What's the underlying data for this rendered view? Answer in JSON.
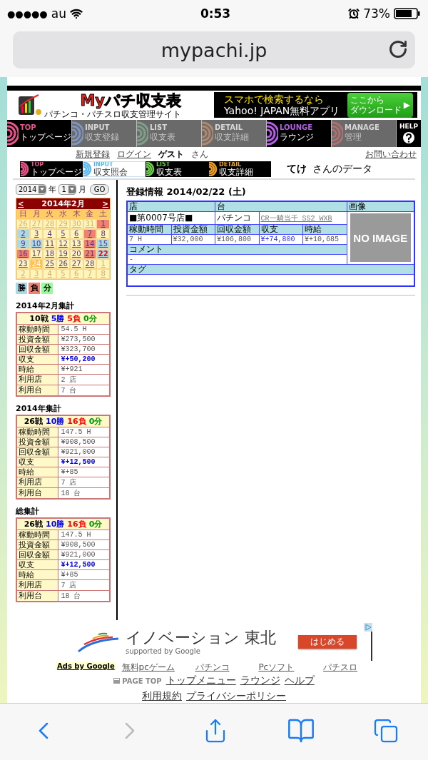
{
  "status_bar": {
    "signal": "●●●●●",
    "carrier": "au",
    "time": "0:53",
    "battery": "73%"
  },
  "browser": {
    "url": "mypachi.jp"
  },
  "header": {
    "logo": "Myパチ収支表",
    "logo_sub": "パチンコ・パチスロ収支管理サイト",
    "ad_line1": "スマホで検索するなら",
    "ad_line2": "Yahoo! JAPAN無料アプリ",
    "ad_button": [
      "ここから",
      "ダウンロード"
    ],
    "ad_arrow": "▶"
  },
  "nav": {
    "tabs": [
      {
        "en": "TOP",
        "ja": "トップページ",
        "color": "#e8558a",
        "disabled": false
      },
      {
        "en": "INPUT",
        "ja": "収支登録",
        "color": "#7f95c0",
        "disabled": true
      },
      {
        "en": "LIST",
        "ja": "収支表",
        "color": "#7f9f88",
        "disabled": true
      },
      {
        "en": "DETAIL",
        "ja": "収支詳細",
        "color": "#b08870",
        "disabled": true
      },
      {
        "en": "LOUNGE",
        "ja": "ラウンジ",
        "color": "#b45ee6",
        "disabled": false
      },
      {
        "en": "MANAGE",
        "ja": "管理",
        "color": "#b07070",
        "disabled": true
      }
    ],
    "help": "HELP"
  },
  "account": {
    "links": [
      "新規登録",
      "ログイン"
    ],
    "user": "ゲスト",
    "suffix": "さん",
    "contact": "お問い合わせ"
  },
  "sub_tabs": [
    {
      "en": "TOP",
      "ja": "トップページ",
      "color": "#e8558a",
      "selected": false
    },
    {
      "en": "INPUT",
      "ja": "収支照会",
      "color": "#5ab8f0",
      "selected": true
    },
    {
      "en": "LIST",
      "ja": "収支表",
      "color": "#6cd048",
      "selected": false
    },
    {
      "en": "DETAIL",
      "ja": "収支詳細",
      "color": "#f0a020",
      "selected": false
    }
  ],
  "owner": {
    "name": "てけ",
    "suffix": "さんのデータ"
  },
  "picker": {
    "year": "2014",
    "year_unit": "年",
    "month": "1",
    "month_unit": "月",
    "go": "GO"
  },
  "calendar": {
    "prev": "<",
    "title": "2014年2月",
    "next": ">",
    "weekdays": [
      "日",
      "月",
      "火",
      "水",
      "木",
      "金",
      "土"
    ],
    "weeks": [
      {
        "days": [
          {
            "day": "26",
            "kind": "other",
            "selected": false
          },
          {
            "day": "27",
            "kind": "other",
            "selected": false
          },
          {
            "day": "28",
            "kind": "other",
            "selected": false
          },
          {
            "day": "29",
            "kind": "other",
            "selected": false
          },
          {
            "day": "30",
            "kind": "other",
            "selected": false
          },
          {
            "day": "31",
            "kind": "other",
            "selected": false
          },
          {
            "day": "1",
            "kind": "lose",
            "selected": false
          }
        ]
      },
      {
        "days": [
          {
            "day": "2",
            "kind": "win",
            "selected": false
          },
          {
            "day": "3",
            "kind": "plain",
            "selected": false
          },
          {
            "day": "4",
            "kind": "plain",
            "selected": false
          },
          {
            "day": "5",
            "kind": "plain",
            "selected": false
          },
          {
            "day": "6",
            "kind": "plain",
            "selected": false
          },
          {
            "day": "7",
            "kind": "lose",
            "selected": false
          },
          {
            "day": "8",
            "kind": "plain",
            "selected": false
          }
        ]
      },
      {
        "days": [
          {
            "day": "9",
            "kind": "win",
            "selected": false
          },
          {
            "day": "10",
            "kind": "win",
            "selected": false
          },
          {
            "day": "11",
            "kind": "plain",
            "selected": false
          },
          {
            "day": "12",
            "kind": "plain",
            "selected": false
          },
          {
            "day": "13",
            "kind": "plain",
            "selected": false
          },
          {
            "day": "14",
            "kind": "lose",
            "selected": false
          },
          {
            "day": "15",
            "kind": "win",
            "selected": false
          }
        ]
      },
      {
        "days": [
          {
            "day": "16",
            "kind": "lose",
            "selected": false
          },
          {
            "day": "17",
            "kind": "plain",
            "selected": false
          },
          {
            "day": "18",
            "kind": "plain",
            "selected": false
          },
          {
            "day": "19",
            "kind": "plain",
            "selected": false
          },
          {
            "day": "20",
            "kind": "plain",
            "selected": false
          },
          {
            "day": "21",
            "kind": "lose",
            "selected": false
          },
          {
            "day": "22",
            "kind": "win",
            "selected": true
          }
        ]
      },
      {
        "days": [
          {
            "day": "23",
            "kind": "plain",
            "selected": false
          },
          {
            "day": "24",
            "kind": "today",
            "selected": false
          },
          {
            "day": "25",
            "kind": "plain",
            "selected": false
          },
          {
            "day": "26",
            "kind": "plain",
            "selected": false
          },
          {
            "day": "27",
            "kind": "plain",
            "selected": false
          },
          {
            "day": "28",
            "kind": "plain",
            "selected": false
          },
          {
            "day": "1",
            "kind": "other",
            "selected": false
          }
        ]
      },
      {
        "days": [
          {
            "day": "2",
            "kind": "other",
            "selected": false
          },
          {
            "day": "3",
            "kind": "other",
            "selected": false
          },
          {
            "day": "4",
            "kind": "other",
            "selected": false
          },
          {
            "day": "5",
            "kind": "other",
            "selected": false
          },
          {
            "day": "6",
            "kind": "other",
            "selected": false
          },
          {
            "day": "7",
            "kind": "other",
            "selected": false
          },
          {
            "day": "8",
            "kind": "other",
            "selected": false
          }
        ]
      }
    ]
  },
  "legend": [
    {
      "label": "勝",
      "color": "#add8e6"
    },
    {
      "label": "負",
      "color": "#f08070"
    },
    {
      "label": "分",
      "color": "#98fb98"
    }
  ],
  "summaries": [
    {
      "title": "2014年2月集計",
      "record": [
        {
          "text": "10戦",
          "color": "#000000"
        },
        {
          "text": "5勝",
          "color": "#0000ff"
        },
        {
          "text": "5負",
          "color": "#ff0000"
        },
        {
          "text": "0分",
          "color": "#009900"
        }
      ],
      "rows": [
        {
          "label": "稼動時間",
          "value": "54.5 H",
          "kind": "plain"
        },
        {
          "label": "投資金額",
          "value": "¥273,500",
          "kind": "plain"
        },
        {
          "label": "回収金額",
          "value": "¥323,700",
          "kind": "plain"
        },
        {
          "label": "収支",
          "value": "¥+50,200",
          "kind": "balance"
        },
        {
          "label": "時給",
          "value": "¥+921",
          "kind": "plain"
        },
        {
          "label": "利用店",
          "value": "2 店",
          "kind": "plain"
        },
        {
          "label": "利用台",
          "value": "7 台",
          "kind": "plain"
        }
      ]
    },
    {
      "title": "2014年集計",
      "record": [
        {
          "text": "26戦",
          "color": "#000000"
        },
        {
          "text": "10勝",
          "color": "#0000ff"
        },
        {
          "text": "16負",
          "color": "#ff0000"
        },
        {
          "text": "0分",
          "color": "#009900"
        }
      ],
      "rows": [
        {
          "label": "稼動時間",
          "value": "147.5 H",
          "kind": "plain"
        },
        {
          "label": "投資金額",
          "value": "¥908,500",
          "kind": "plain"
        },
        {
          "label": "回収金額",
          "value": "¥921,000",
          "kind": "plain"
        },
        {
          "label": "収支",
          "value": "¥+12,500",
          "kind": "balance"
        },
        {
          "label": "時給",
          "value": "¥+85",
          "kind": "plain"
        },
        {
          "label": "利用店",
          "value": "7 店",
          "kind": "plain"
        },
        {
          "label": "利用台",
          "value": "18 台",
          "kind": "plain"
        }
      ]
    },
    {
      "title": "総集計",
      "record": [
        {
          "text": "26戦",
          "color": "#000000"
        },
        {
          "text": "10勝",
          "color": "#0000ff"
        },
        {
          "text": "16負",
          "color": "#ff0000"
        },
        {
          "text": "0分",
          "color": "#009900"
        }
      ],
      "rows": [
        {
          "label": "稼動時間",
          "value": "147.5 H",
          "kind": "plain"
        },
        {
          "label": "投資金額",
          "value": "¥908,500",
          "kind": "plain"
        },
        {
          "label": "回収金額",
          "value": "¥921,000",
          "kind": "plain"
        },
        {
          "label": "収支",
          "value": "¥+12,500",
          "kind": "balance"
        },
        {
          "label": "時給",
          "value": "¥+85",
          "kind": "plain"
        },
        {
          "label": "利用店",
          "value": "7 店",
          "kind": "plain"
        },
        {
          "label": "利用台",
          "value": "18 台",
          "kind": "plain"
        }
      ]
    }
  ],
  "detail": {
    "title": "登録情報 2014/02/22 (土)",
    "shop_label": "店",
    "machine_label": "台",
    "image_label": "画像",
    "shop": "■第0007号店■",
    "machine_type": "パチンコ",
    "machine": "CR一騎当千 SS2 WXB",
    "image_text": "NO IMAGE",
    "stats": [
      {
        "label": "稼動時間",
        "value": "7 H",
        "kind": "plain"
      },
      {
        "label": "投資金額",
        "value": "¥32,000",
        "kind": "plain"
      },
      {
        "label": "回収金額",
        "value": "¥106,800",
        "kind": "plain"
      },
      {
        "label": "収支",
        "value": "¥+74,800",
        "kind": "balance"
      },
      {
        "label": "時給",
        "value": "¥+10,685",
        "kind": "plain"
      }
    ],
    "comment_label": "コメント",
    "comment": "-",
    "tag_label": "タグ"
  },
  "footer": {
    "ad": {
      "title": "イノベーション 東北",
      "sub": "supported by Google",
      "button": "はじめる"
    },
    "ads_label": "Ads by Google",
    "ad_links": [
      "無料pcゲーム",
      "パチンコ",
      "Pcソフト",
      "パチスロ"
    ],
    "page_top": "PAGE TOP",
    "link_rows": [
      {
        "links": [
          "トップメニュー",
          "ラウンジ",
          "ヘルプ"
        ]
      },
      {
        "links": [
          "利用規約",
          "プライバシーポリシー"
        ]
      }
    ]
  }
}
